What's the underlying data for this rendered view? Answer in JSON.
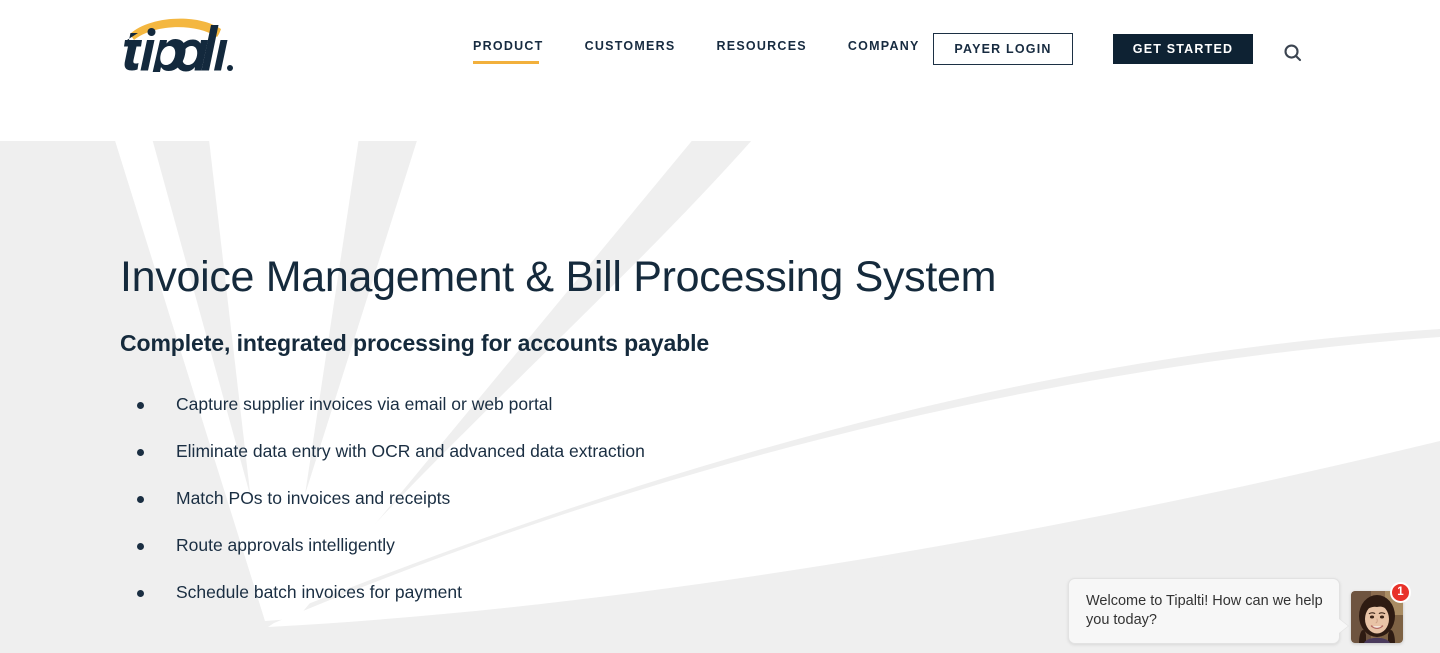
{
  "brand": {
    "name": "tipalti",
    "logo_alt": "tipalti",
    "accent_color": "#F2B03C",
    "navy_color": "#0E2233",
    "hero_bg_color": "#EFEFEF"
  },
  "header": {
    "nav": [
      {
        "label": "PRODUCT",
        "active": true
      },
      {
        "label": "CUSTOMERS",
        "active": false
      },
      {
        "label": "RESOURCES",
        "active": false
      },
      {
        "label": "COMPANY",
        "active": false
      }
    ],
    "payer_login_label": "PAYER LOGIN",
    "get_started_label": "GET STARTED",
    "search_icon": "search-icon"
  },
  "hero": {
    "headline": "Invoice Management & Bill Processing System",
    "subheadline": "Complete, integrated processing for accounts payable",
    "bullets": [
      "Capture supplier invoices via email or web portal",
      "Eliminate data entry with OCR and advanced data extraction",
      "Match POs to invoices and receipts",
      "Route approvals intelligently",
      "Schedule batch invoices for payment"
    ]
  },
  "chat": {
    "message": "Welcome to Tipalti! How can we help you today?",
    "badge_count": "1",
    "badge_color": "#E8322A",
    "avatar_alt": "support-agent-avatar"
  }
}
